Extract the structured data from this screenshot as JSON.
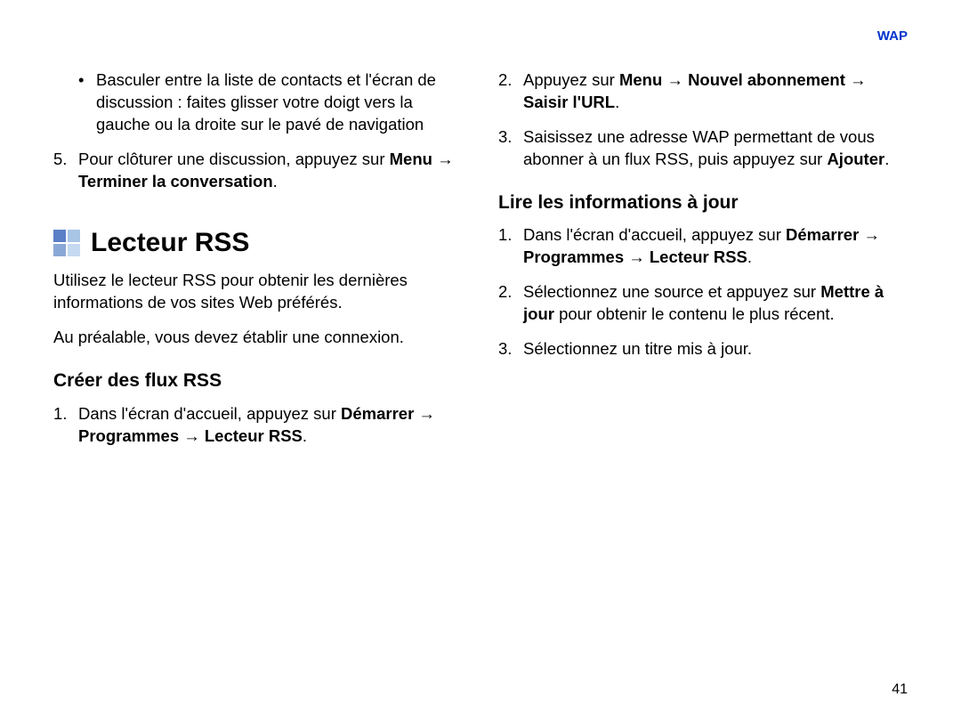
{
  "header": {
    "label": "WAP"
  },
  "page_number": "41",
  "left": {
    "bullet": "Basculer entre la liste de contacts et l'écran de discussion : faites glisser votre doigt vers la gauche ou la droite sur le pavé de navigation",
    "step5_a": "Pour clôturer une discussion, appuyez sur ",
    "step5_b": "Menu → Terminer la conversation",
    "step5_c": ".",
    "h1": "Lecteur RSS",
    "p1": "Utilisez le lecteur RSS pour obtenir les dernières informations de vos sites Web préférés.",
    "p2": "Au préalable, vous devez établir une connexion.",
    "h2": "Créer des flux RSS",
    "c1_a": "Dans l'écran d'accueil, appuyez sur ",
    "c1_b": "Démarrer → Programmes → Lecteur RSS",
    "c1_c": "."
  },
  "right": {
    "s2_a": "Appuyez sur ",
    "s2_b": "Menu → Nouvel abonnement → Saisir l'URL",
    "s2_c": ".",
    "s3_a": "Saisissez une adresse WAP permettant de vous abonner à un flux RSS, puis appuyez sur ",
    "s3_b": "Ajouter",
    "s3_c": ".",
    "h2": "Lire les informations à jour",
    "r1_a": "Dans l'écran d'accueil, appuyez sur ",
    "r1_b": "Démarrer → Programmes → Lecteur RSS",
    "r1_c": ".",
    "r2_a": "Sélectionnez une source et appuyez sur ",
    "r2_b": "Mettre à jour",
    "r2_c": " pour obtenir le contenu le plus récent.",
    "r3": "Sélectionnez un titre mis à jour."
  }
}
